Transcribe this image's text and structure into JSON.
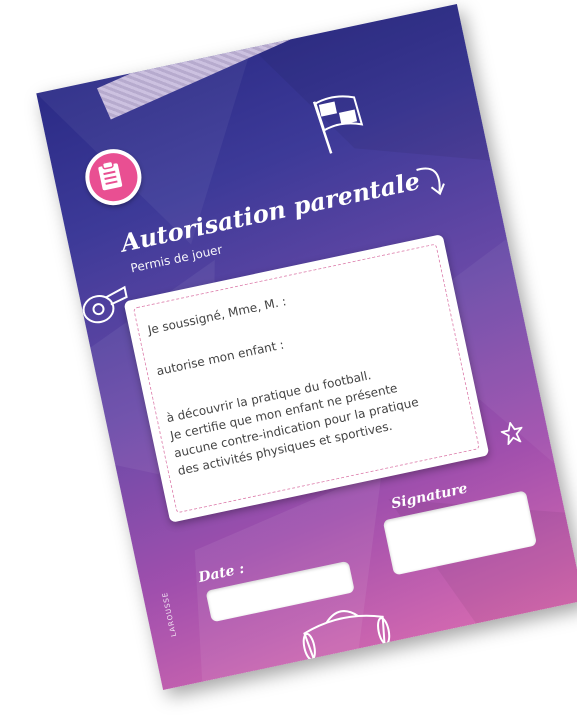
{
  "card": {
    "title": "Autorisation parentale",
    "subtitle": "Permis de jouer",
    "lines": [
      "Je soussigné, Mme, M. :",
      "autorise mon enfant :",
      "à découvrir la pratique du football.",
      "Je certifie que mon enfant ne présente",
      "aucune contre-indication pour la pratique",
      "des activités physiques et sportives."
    ],
    "date_label": "Date :",
    "signature_label": "Signature",
    "publisher": "LAROUSSE"
  },
  "colors": {
    "gradient_top": "#2b2b86",
    "gradient_bottom": "#d86bb0",
    "badge": "#e94f92",
    "dashed_border": "#e08bb4"
  },
  "icons": [
    "clipboard-icon",
    "checkered-flag-icon",
    "whistle-icon",
    "curved-arrow-icon",
    "star-icon",
    "sports-bag-icon"
  ]
}
